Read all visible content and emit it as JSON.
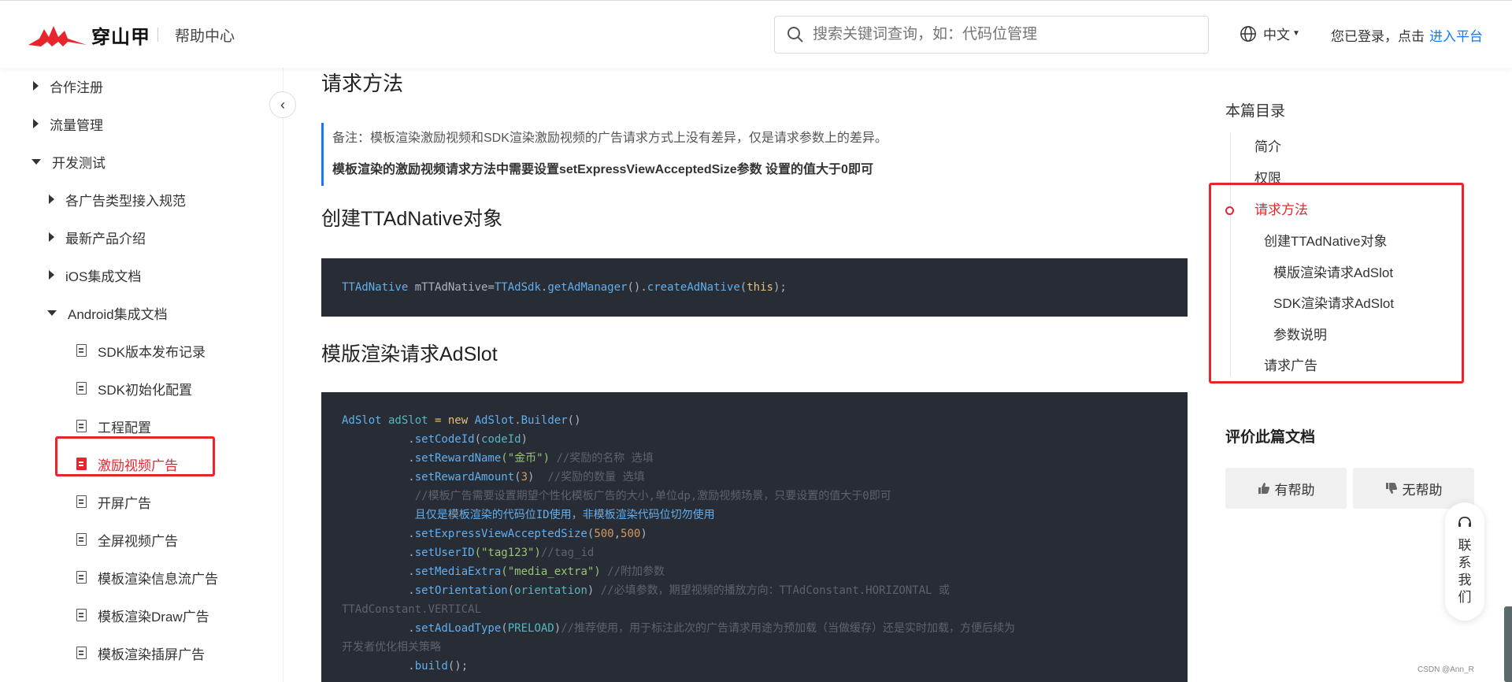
{
  "header": {
    "brand": "穿山甲",
    "help_center": "帮助中心",
    "search_placeholder": "搜索关键词查询，如：代码位管理",
    "language": "中文",
    "login_text": "您已登录，点击",
    "login_link": "进入平台"
  },
  "sidebar": {
    "items": [
      {
        "label": "合作注册",
        "state": "collapsed"
      },
      {
        "label": "流量管理",
        "state": "collapsed"
      },
      {
        "label": "开发测试",
        "state": "expanded"
      },
      {
        "label": "各广告类型接入规范",
        "state": "collapsed"
      },
      {
        "label": "最新产品介绍",
        "state": "collapsed"
      },
      {
        "label": "iOS集成文档",
        "state": "collapsed"
      },
      {
        "label": "Android集成文档",
        "state": "expanded"
      },
      {
        "label": "SDK版本发布记录",
        "state": "doc"
      },
      {
        "label": "SDK初始化配置",
        "state": "doc"
      },
      {
        "label": "工程配置",
        "state": "doc"
      },
      {
        "label": "激励视频广告",
        "state": "active"
      },
      {
        "label": "开屏广告",
        "state": "doc"
      },
      {
        "label": "全屏视频广告",
        "state": "doc"
      },
      {
        "label": "模板渲染信息流广告",
        "state": "doc"
      },
      {
        "label": "模板渲染Draw广告",
        "state": "doc"
      },
      {
        "label": "模板渲染插屏广告",
        "state": "doc"
      }
    ]
  },
  "main": {
    "section_title": "请求方法",
    "note_line1": "备注：模板渲染激励视频和SDK渲染激励视频的广告请求方式上没有差异，仅是请求参数上的差异。",
    "note_line2": "模板渲染的激励视频请求方法中需要设置setExpressViewAcceptedSize参数 设置的值大于0即可",
    "create_title": "创建TTAdNative对象",
    "adslot_title": "模版渲染请求AdSlot",
    "code1": {
      "t1": "TTAdNative",
      "t2": " mTTAdNative=",
      "t3": "TTAdSdk",
      "t4": ".",
      "t5": "getAdManager",
      "t6": "().",
      "t7": "createAdNative",
      "t8": "(",
      "t9": "this",
      "t10": ");"
    },
    "code2": {
      "l1a": "AdSlot",
      "l1b": " adSlot ",
      "l1c": "=",
      "l1d": " new ",
      "l1e": "AdSlot",
      "l1f": ".",
      "l1g": "Builder",
      "l1h": "()",
      "l2a": "          .",
      "l2b": "setCodeId",
      "l2c": "(",
      "l2d": "codeId",
      "l2e": ")",
      "l3a": "          .",
      "l3b": "setRewardName",
      "l3c": "(\"金币\")",
      "l3d": " //奖励的名称 选填",
      "l4a": "          .",
      "l4b": "setRewardAmount",
      "l4c": "(",
      "l4d": "3",
      "l4e": ")",
      "l4f": "  //奖励的数量 选填",
      "l5": "           //模板广告需要设置期望个性化模板广告的大小,单位dp,激励视频场景，只要设置的值大于0即可",
      "l6": "           且仅是模板渲染的代码位ID使用，非模板渲染代码位切勿使用",
      "l7a": "          .",
      "l7b": "setExpressViewAcceptedSize",
      "l7c": "(",
      "l7d": "500",
      "l7e": ",",
      "l7f": "500",
      "l7g": ")",
      "l8a": "          .",
      "l8b": "setUserID",
      "l8c": "(\"tag123\")",
      "l8d": "//tag_id",
      "l9a": "          .",
      "l9b": "setMediaExtra",
      "l9c": "(\"media_extra\")",
      "l9d": " //附加参数",
      "l10a": "          .",
      "l10b": "setOrientation",
      "l10c": "(",
      "l10d": "orientation",
      "l10e": ")",
      "l10f": " //必填参数，期望视频的播放方向：TTAdConstant.HORIZONTAL 或",
      "l11": "TTAdConstant.VERTICAL",
      "l12a": "          .",
      "l12b": "setAdLoadType",
      "l12c": "(",
      "l12d": "PRELOAD",
      "l12e": ")",
      "l12f": "//推荐使用，用于标注此次的广告请求用途为预加载（当做缓存）还是实时加载，方便后续为",
      "l13": "开发者优化相关策略",
      "l14a": "          .",
      "l14b": "build",
      "l14c": "();"
    }
  },
  "toc": {
    "title": "本篇目录",
    "items": [
      "简介",
      "权限",
      "请求方法",
      "创建TTAdNative对象",
      "模版渲染请求AdSlot",
      "SDK渲染请求AdSlot",
      "参数说明",
      "请求广告"
    ]
  },
  "rating": {
    "title": "评价此篇文档",
    "helpful": "有帮助",
    "not_helpful": "无帮助"
  },
  "contact": {
    "label": "联系我们"
  },
  "watermark": "CSDN @Ann_R",
  "colors": {
    "accent": "#e8242d",
    "link": "#1677ff",
    "code_bg": "#282c34"
  }
}
